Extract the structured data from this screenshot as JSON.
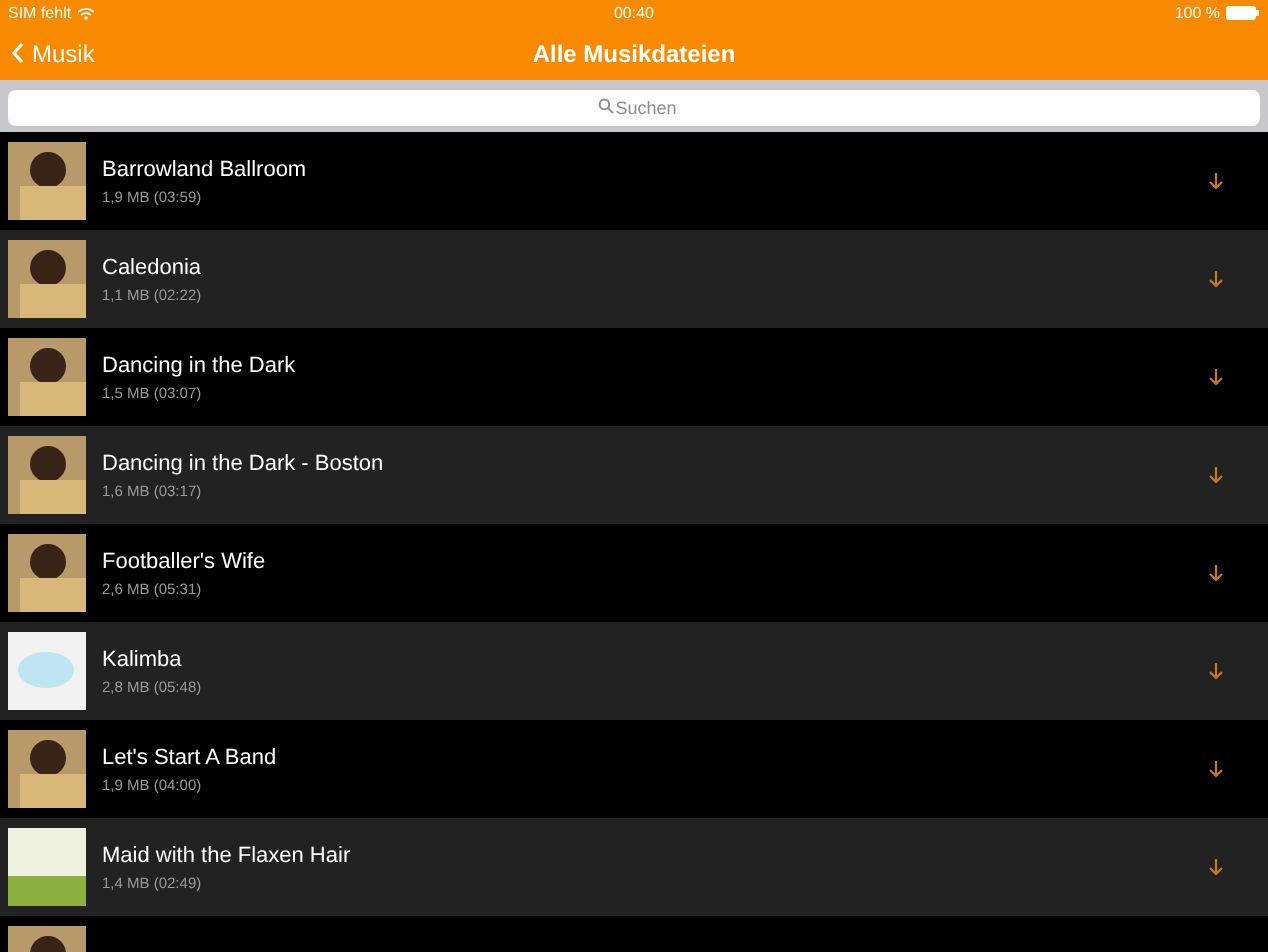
{
  "status_bar": {
    "carrier": "SIM fehlt",
    "time": "00:40",
    "battery": "100 %"
  },
  "nav_bar": {
    "back": "Musik",
    "title": "Alle Musikdateien"
  },
  "search": {
    "placeholder": "Suchen"
  },
  "songs": [
    {
      "title": "Barrowland Ballroom",
      "info": "1,9 MB (03:59)",
      "kind": "portrait"
    },
    {
      "title": "Caledonia",
      "info": "1,1 MB (02:22)",
      "kind": "portrait"
    },
    {
      "title": "Dancing in the Dark",
      "info": "1,5 MB (03:07)",
      "kind": "portrait"
    },
    {
      "title": "Dancing in the Dark - Boston",
      "info": "1,6 MB (03:17)",
      "kind": "portrait"
    },
    {
      "title": "Footballer's Wife",
      "info": "2,6 MB (05:31)",
      "kind": "portrait"
    },
    {
      "title": "Kalimba",
      "info": "2,8 MB (05:48)",
      "kind": "cartoon"
    },
    {
      "title": "Let's Start A Band",
      "info": "1,9 MB (04:00)",
      "kind": "portrait"
    },
    {
      "title": "Maid with the Flaxen Hair",
      "info": "1,4 MB (02:49)",
      "kind": "meadow"
    },
    {
      "kind": "portrait"
    }
  ]
}
